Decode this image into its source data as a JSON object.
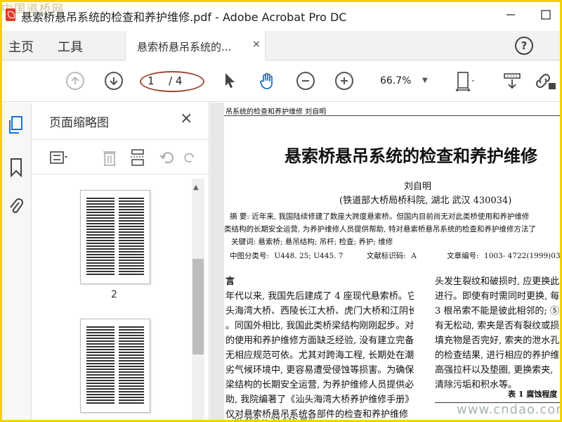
{
  "window": {
    "title": "悬索桥悬吊系统的检查和养护维修.pdf - Adobe Acrobat Pro DC",
    "watermark": "中国道桥网"
  },
  "menu": {
    "home": "主页",
    "tools": "工具"
  },
  "tab": {
    "label": "悬索桥悬吊系统的...",
    "close": "×"
  },
  "toolbar": {
    "current_page": "1",
    "total_pages": "/ 4",
    "zoom": "66.7%"
  },
  "thumbnails_panel": {
    "title": "页面缩略图",
    "close": "×",
    "thumbnails": [
      {
        "label": "2"
      },
      {
        "label": ""
      }
    ]
  },
  "document": {
    "running_head": "吊系统的检查和养护维修     刘自明",
    "title": "悬索桥悬吊系统的检查和养护维修",
    "author": "刘自明",
    "affiliation": "(铁道部大桥局桥科院, 湖北 武汉 430034)",
    "abstract_line1": "摘  要: 近年来, 我国陆续修建了数座大跨度悬索桥。但国内目前尚无对此类桥使用和养护维修",
    "abstract_line2": "类结构的长期安全运营, 为养护维修人员提供帮助, 特对悬索桥悬吊系统的检查和养护维修方法了",
    "keywords": "关键词: 悬索桥; 悬吊结构; 吊杆; 检查; 养护; 维修",
    "cls_label": "中图分类号:",
    "cls_value": "U448. 25; U445. 7",
    "doccode_label": "文献标识码:",
    "doccode_value": "A",
    "article_label": "文章编号:",
    "article_value": "1003- 4722(1999)03- 00",
    "section_heading": "言",
    "left_column": [
      "年代以来, 我国先后建成了 4 座现代悬索桥。它",
      "头海湾大桥、西陵长江大桥、虎门大桥和江阴长",
      "。同国外相比, 我国此类桥梁结构刚刚起步。对",
      "的使用和养护维修方面缺乏经验, 没有建立完备",
      "无相应规范可依。尤其对跨海工程, 长期处在潮",
      "劣气候环境中, 更容易遭受侵蚀等损害。为确保",
      "梁结构的长期安全运营, 为养护维修人员提供必",
      "助, 我院编著了《汕头海湾大桥养护维修手册》一",
      "仅对悬索桥悬吊系统各部件的检查和养护维修"
    ],
    "right_column": [
      "头发生裂纹和破损时, 应更换此",
      "进行。即使有时需同时更换, 每次",
      "3 根吊索不能是彼此相邻的; ⑤",
      "有无松动, 索夹是否有裂纹或损",
      "填充物是否完好, 索夹的泄水孔",
      "的检查结果, 进行相应的养护维",
      "高强拉杆以及垫圈, 更换索夹,",
      "清除污垢和积水等。"
    ],
    "table_title": "表 1   腐蚀程度",
    "bottom_partial": "20.450 × 27.610 厘米"
  },
  "watermark_bottom": "www.cndao.com",
  "colors": {
    "frame": "#f2d100",
    "annotation_ellipse": "#9b4b33",
    "nav_active": "#1a73c8"
  }
}
